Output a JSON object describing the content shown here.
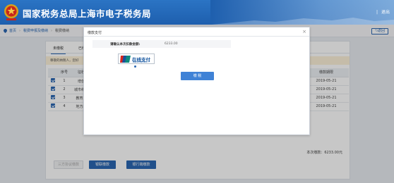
{
  "header": {
    "site_title": "国家税务总局上海市电子税务局",
    "logout_sep": "|",
    "logout_label": "退出",
    "emblem_icon": "tax-emblem-icon"
  },
  "breadcrumb": {
    "items": [
      "首页",
      "税费申报及缴纳",
      "税费缴纳"
    ],
    "back_label": "返回"
  },
  "main": {
    "tabs": [
      {
        "label": "未缴税"
      },
      {
        "label": "已缴"
      }
    ],
    "notice": "尊敬的纳税人，您好",
    "table": {
      "headers": [
        "",
        "序号",
        "征收",
        "",
        "",
        "缴款期限"
      ],
      "rows": [
        {
          "no": "1",
          "item": "增值",
          "deadline": "2019-05-21"
        },
        {
          "no": "2",
          "item": "城市维护",
          "deadline": "2019-05-21"
        },
        {
          "no": "3",
          "item": "教育费",
          "deadline": "2019-05-21"
        },
        {
          "no": "4",
          "item": "地方教",
          "deadline": "2019-05-21"
        }
      ]
    },
    "total": "本次缴款：6233.00元",
    "buttons": {
      "disabled": "三方协议缴款",
      "primary1": "银联缴款",
      "primary2": "银行端缴款"
    }
  },
  "modal": {
    "title": "缴款支付",
    "close": "×",
    "amount_label": "请确认本次扣款金额:",
    "amount_value": "6233.00",
    "unionpay_text": "在线支付",
    "unionpay_sub": "Online Payment",
    "pay_button": "缴 税"
  },
  "colors": {
    "header_blue": "#1e5fae",
    "accent": "#2b67b2",
    "pay_button": "#3f82d6",
    "notice_bg": "#fdf1d9"
  }
}
